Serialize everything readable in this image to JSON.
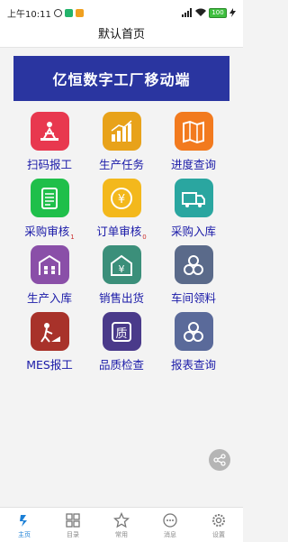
{
  "status": {
    "time": "上午10:11",
    "battery": "100"
  },
  "header": {
    "title": "默认首页"
  },
  "banner": {
    "title": "亿恒数字工厂移动端"
  },
  "grid": [
    {
      "label": "扫码报工",
      "icon": "scan-report-icon",
      "color": "#e8384f"
    },
    {
      "label": "生产任务",
      "icon": "production-task-icon",
      "color": "#e8a21a"
    },
    {
      "label": "进度查询",
      "icon": "progress-map-icon",
      "color": "#f27a1e"
    },
    {
      "label": "采购审核",
      "badge": "1",
      "icon": "purchase-review-icon",
      "color": "#1fbf4a"
    },
    {
      "label": "订单审核",
      "badge": "0",
      "icon": "order-review-icon",
      "color": "#f3b81c"
    },
    {
      "label": "采购入库",
      "icon": "purchase-warehouse-icon",
      "color": "#2aa6a0"
    },
    {
      "label": "生产入库",
      "icon": "production-warehouse-icon",
      "color": "#8a4fa8"
    },
    {
      "label": "销售出货",
      "icon": "sales-shipment-icon",
      "color": "#3b8f7a"
    },
    {
      "label": "车间领料",
      "icon": "workshop-material-icon",
      "color": "#5a6a8a"
    },
    {
      "label": "MES报工",
      "icon": "mes-report-icon",
      "color": "#a8322a"
    },
    {
      "label": "品质检查",
      "icon": "quality-check-icon",
      "color": "#4a3a8a"
    },
    {
      "label": "报表查询",
      "icon": "report-query-icon",
      "color": "#5a6a9a"
    }
  ],
  "tabs": [
    {
      "label": "主页",
      "icon": "home-icon"
    },
    {
      "label": "目录",
      "icon": "catalog-icon"
    },
    {
      "label": "常用",
      "icon": "star-icon"
    },
    {
      "label": "消息",
      "icon": "message-icon"
    },
    {
      "label": "设置",
      "icon": "settings-icon"
    }
  ]
}
